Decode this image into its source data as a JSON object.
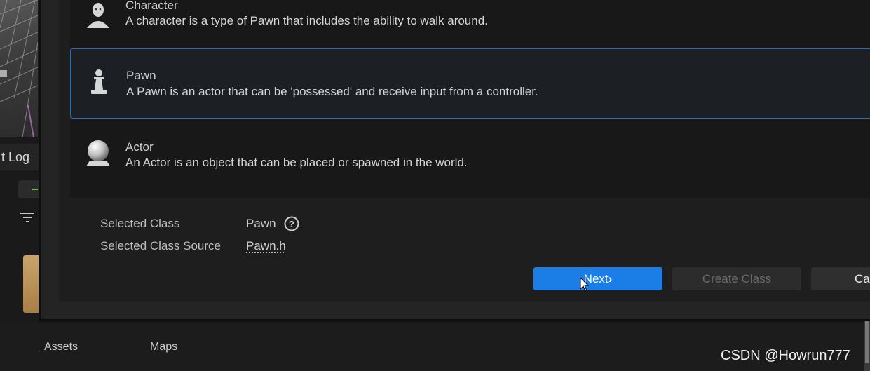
{
  "editor": {
    "log_tab": "t Log",
    "bottom_tabs": [
      "Assets",
      "Maps"
    ]
  },
  "dialog": {
    "classes": [
      {
        "title": "Character",
        "description": "A character is a type of Pawn that includes the ability to walk around.",
        "icon": "character-icon"
      },
      {
        "title": "Pawn",
        "description": "A Pawn is an actor that can be 'possessed' and receive input from a controller.",
        "icon": "pawn-icon",
        "selected": true
      },
      {
        "title": "Actor",
        "description": "An Actor is an object that can be placed or spawned in the world.",
        "icon": "actor-sphere-icon"
      }
    ],
    "selected_class_label": "Selected Class",
    "selected_class_value": "Pawn",
    "selected_source_label": "Selected Class Source",
    "selected_source_value": "Pawn.h",
    "buttons": {
      "next": "Next",
      "create": "Create Class",
      "cancel": "Ca"
    }
  },
  "watermark": "CSDN @Howrun777",
  "colors": {
    "accent": "#1a7ee6",
    "selection_border": "#1f6fbf"
  }
}
